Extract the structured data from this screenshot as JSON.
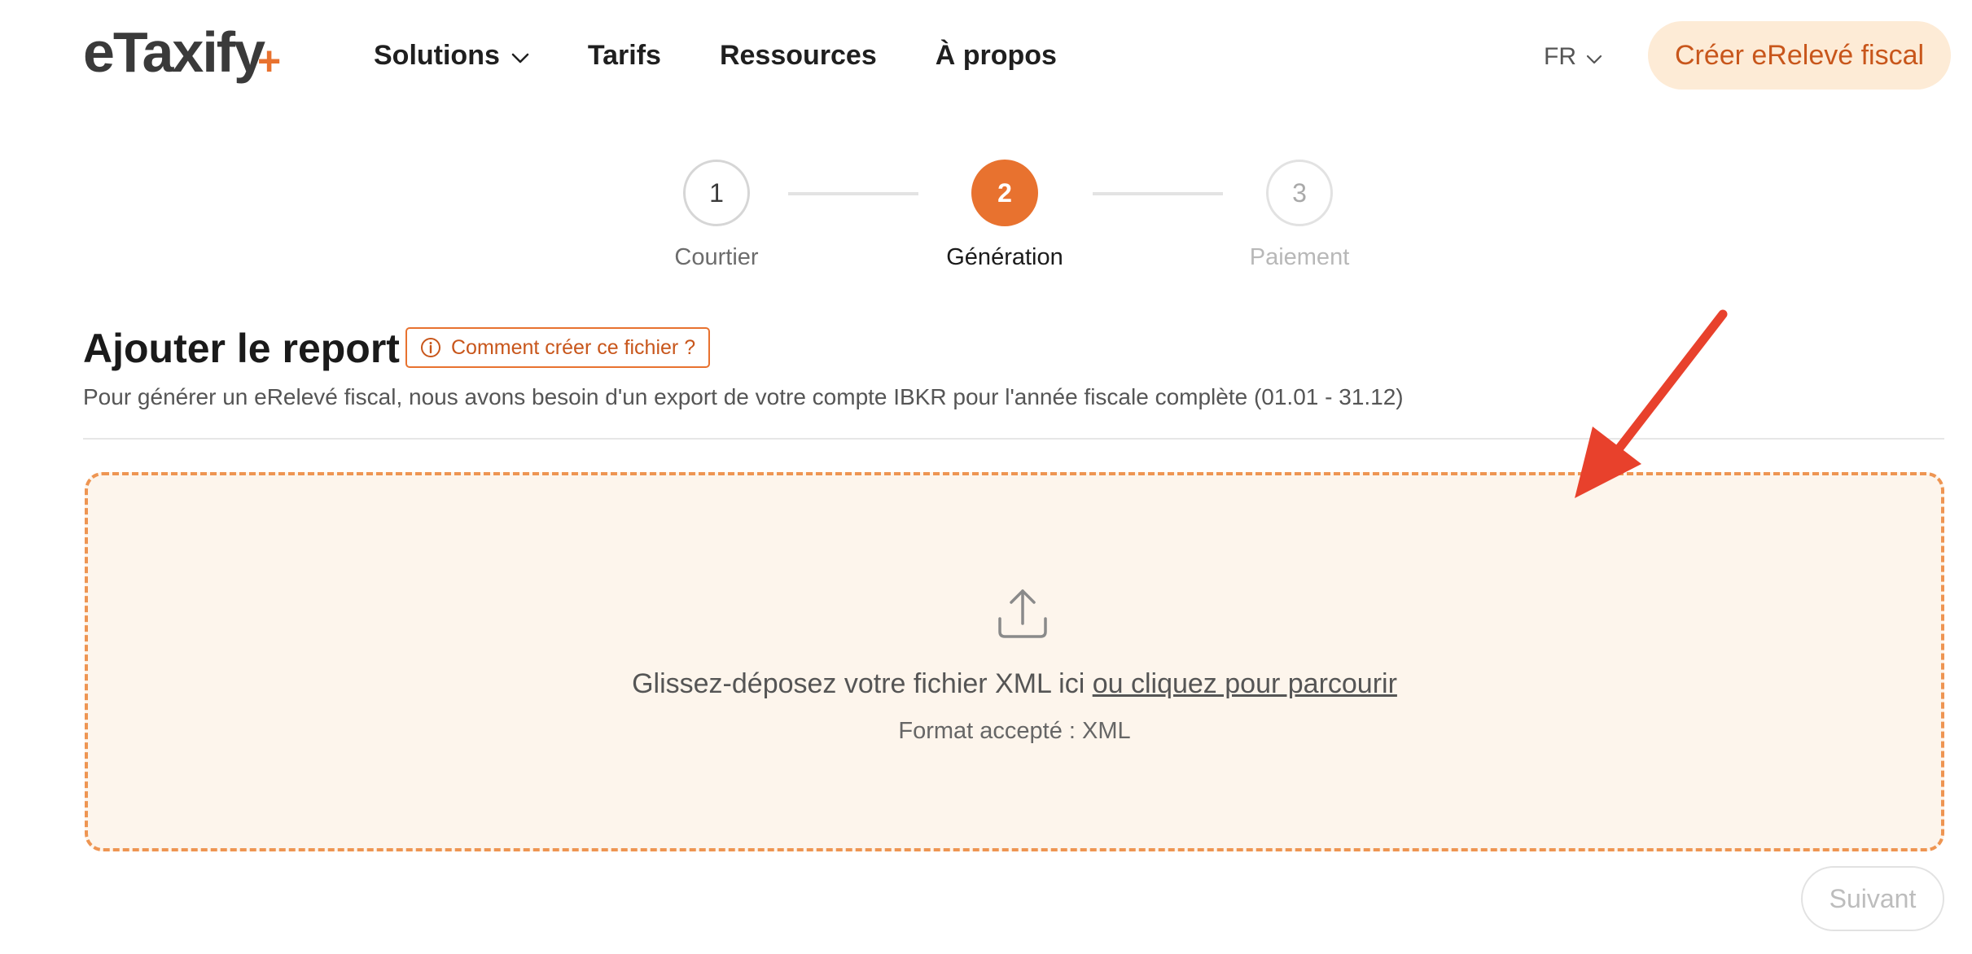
{
  "header": {
    "logo_text": "eTaxify",
    "logo_plus": "+",
    "nav": [
      {
        "label": "Solutions",
        "has_dropdown": true
      },
      {
        "label": "Tarifs",
        "has_dropdown": false
      },
      {
        "label": "Ressources",
        "has_dropdown": false
      },
      {
        "label": "À propos",
        "has_dropdown": false
      }
    ],
    "language": "FR",
    "cta_label": "Créer eRelevé fiscal"
  },
  "stepper": {
    "steps": [
      {
        "number": "1",
        "label": "Courtier",
        "state": "completed"
      },
      {
        "number": "2",
        "label": "Génération",
        "state": "active"
      },
      {
        "number": "3",
        "label": "Paiement",
        "state": "upcoming"
      }
    ]
  },
  "section": {
    "title": "Ajouter le report",
    "help_label": "Comment créer ce fichier ?",
    "description": "Pour générer un eRelevé fiscal, nous avons besoin d'un export de votre compte IBKR pour l'année fiscale complète (01.01 - 31.12)"
  },
  "dropzone": {
    "text": "Glissez-déposez votre fichier XML ici",
    "link_text": "ou cliquez pour parcourir",
    "accepted_format": "Format accepté : XML",
    "icon": "upload-icon"
  },
  "footer": {
    "next_label": "Suivant",
    "next_disabled": true
  },
  "colors": {
    "accent": "#e8722f",
    "accent_light": "#fdebd6",
    "dropzone_bg": "#fdf5ec",
    "annotation_arrow": "#e8412c"
  }
}
